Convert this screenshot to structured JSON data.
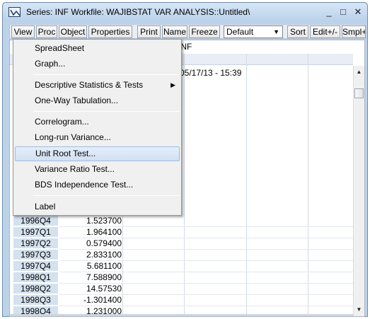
{
  "window": {
    "title": "Series: INF   Workfile: WAJIBSTAT VAR ANALYSIS::Untitled\\",
    "minimize_glyph": "_",
    "maximize_glyph": "□",
    "close_glyph": "✕"
  },
  "toolbar": {
    "buttons": [
      "View",
      "Proc",
      "Object",
      "Properties",
      "Print",
      "Name",
      "Freeze"
    ],
    "select_value": "Default",
    "right_buttons": [
      "Sort",
      "Edit+/-",
      "Smpl+"
    ]
  },
  "sheet": {
    "column_name": "INF",
    "timestamp": "05/17/13 - 15:39",
    "rows": [
      {
        "label": "1996Q4",
        "value": "1.523700"
      },
      {
        "label": "1997Q1",
        "value": "1.964100"
      },
      {
        "label": "1997Q2",
        "value": "0.579400"
      },
      {
        "label": "1997Q3",
        "value": "2.833100"
      },
      {
        "label": "1997Q4",
        "value": "5.681100"
      },
      {
        "label": "1998Q1",
        "value": "7.588900"
      },
      {
        "label": "1998Q2",
        "value": "14.57530"
      },
      {
        "label": "1998Q3",
        "value": "-1.301400"
      },
      {
        "label": "1998Q4",
        "value": "1.231000"
      }
    ]
  },
  "menu": {
    "items": [
      {
        "label": "SpreadSheet"
      },
      {
        "label": "Graph..."
      },
      {
        "label": "Descriptive Statistics & Tests",
        "submenu_arrow": "▶"
      },
      {
        "label": "One-Way Tabulation..."
      },
      {
        "label": "Correlogram..."
      },
      {
        "label": "Long-run Variance..."
      },
      {
        "label": "Unit Root Test...",
        "highlighted": true
      },
      {
        "label": "Variance Ratio Test..."
      },
      {
        "label": "BDS Independence Test..."
      },
      {
        "label": "Label"
      }
    ]
  },
  "colors": {
    "window_frame": "#bcd3ea",
    "row_label_bg": "#d4e1ef",
    "menu_bg": "#f0f0f0",
    "menu_highlight": "#d2e0f3"
  },
  "icons": {
    "app": "eviews-series-icon",
    "submenu": "chevron-right-icon",
    "scroll_up": "scroll-up-arrow-icon",
    "scroll_down": "scroll-down-arrow-icon",
    "dropdown": "dropdown-arrow-icon"
  }
}
